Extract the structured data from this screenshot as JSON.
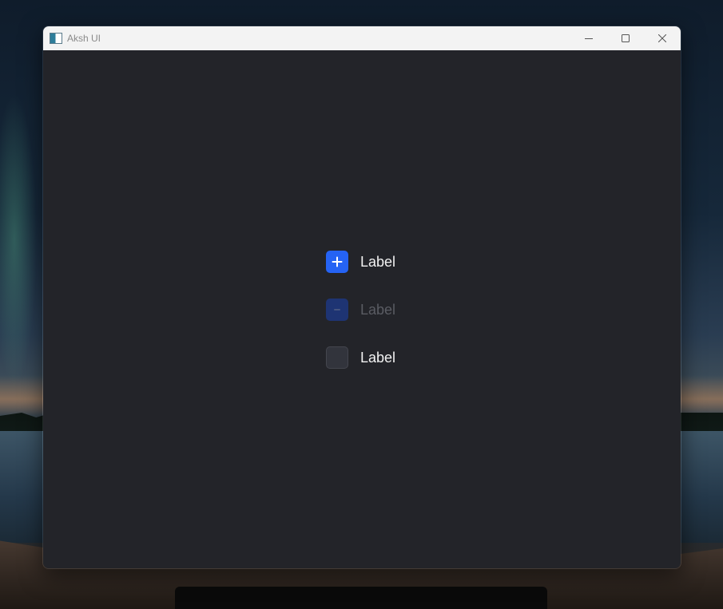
{
  "window": {
    "title": "Aksh UI",
    "icon": "app-window-icon"
  },
  "caption": {
    "minimize_icon": "minimize-icon",
    "maximize_icon": "maximize-icon",
    "close_icon": "close-icon"
  },
  "checkboxes": [
    {
      "label": "Label",
      "state": "checked",
      "icon": "plus-icon",
      "enabled": true
    },
    {
      "label": "Label",
      "state": "indeterminate",
      "icon": "minus-icon",
      "enabled": false
    },
    {
      "label": "Label",
      "state": "unchecked",
      "icon": "",
      "enabled": true
    }
  ],
  "colors": {
    "accent": "#2563f4",
    "accent_disabled": "#1e3473",
    "background": "#232429",
    "titlebar": "#f3f3f3"
  }
}
